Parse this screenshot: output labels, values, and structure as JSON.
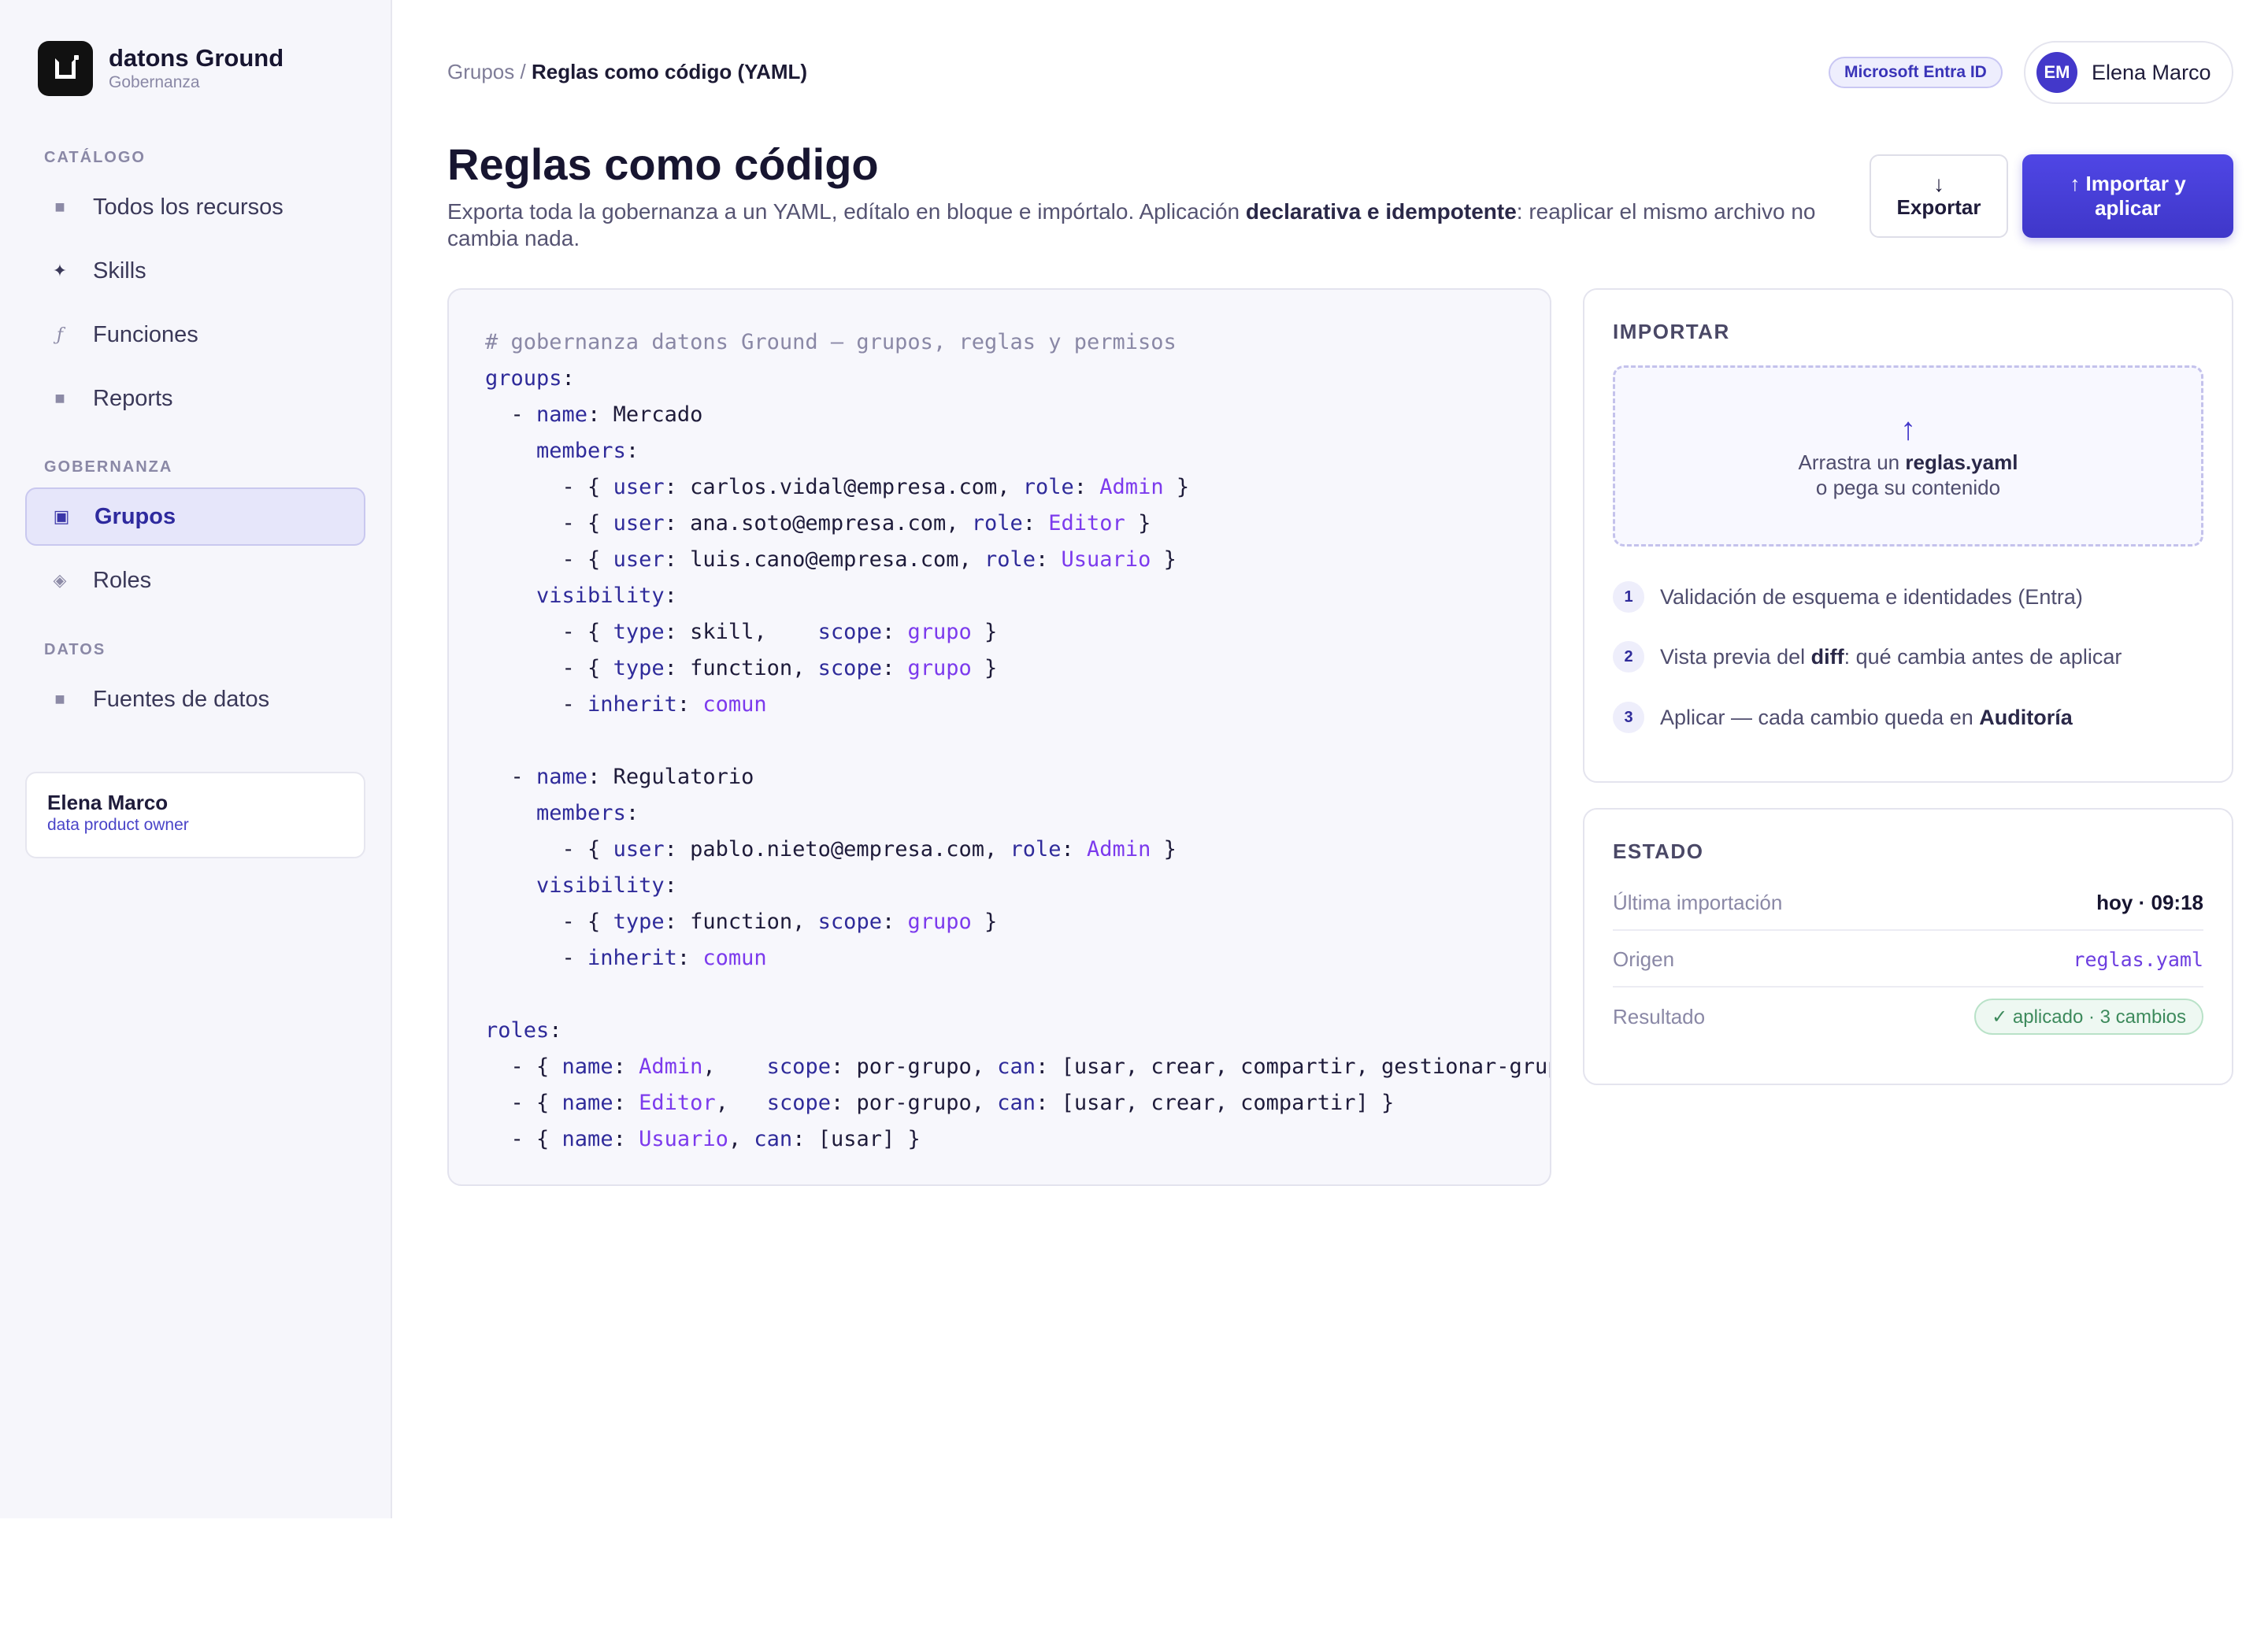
{
  "brand": {
    "name": "datons Ground",
    "subtitle": "Gobernanza"
  },
  "sidebar": {
    "sections": {
      "catalog": "CATÁLOGO",
      "governance": "GOBERNANZA",
      "data": "DATOS"
    },
    "items": [
      {
        "label": "Todos los recursos",
        "icon": "grid-square-icon"
      },
      {
        "label": "Skills",
        "icon": "sparkle-icon"
      },
      {
        "label": "Funciones",
        "icon": "function-icon"
      },
      {
        "label": "Reports",
        "icon": "report-square-icon"
      },
      {
        "label": "Grupos",
        "icon": "group-square-icon",
        "active": true
      },
      {
        "label": "Roles",
        "icon": "diamond-icon"
      },
      {
        "label": "Fuentes de datos",
        "icon": "database-square-icon"
      }
    ],
    "user": {
      "name": "Elena Marco",
      "role": "data product owner"
    }
  },
  "topbar": {
    "breadcrumb_parent": "Grupos",
    "breadcrumb_sep": "/",
    "breadcrumb_current": "Reglas como código (YAML)",
    "idp_badge": "Microsoft Entra ID",
    "user_initials": "EM",
    "user_name": "Elena Marco"
  },
  "header": {
    "title": "Reglas como código",
    "desc_pre": "Exporta toda la gobernanza a un YAML, edítalo en bloque e impórtalo. Aplicación ",
    "desc_bold": "declarativa e idempotente",
    "desc_post": ": reaplicar el mismo archivo no cambia nada.",
    "export_icon": "↓",
    "export_label": "Exportar",
    "import_label": "↑ Importar y aplicar"
  },
  "yaml": {
    "comment": "# gobernanza datons Ground — grupos, reglas y permisos",
    "groups": [
      {
        "name": "Mercado",
        "members": [
          {
            "user": "carlos.vidal@empresa.com",
            "role": "Admin"
          },
          {
            "user": "ana.soto@empresa.com",
            "role": "Editor"
          },
          {
            "user": "luis.cano@empresa.com",
            "role": "Usuario"
          }
        ],
        "visibility": [
          {
            "type": "skill",
            "scope": "grupo"
          },
          {
            "type": "function",
            "scope": "grupo"
          }
        ],
        "inherit": "comun"
      },
      {
        "name": "Regulatorio",
        "members": [
          {
            "user": "pablo.nieto@empresa.com",
            "role": "Admin"
          }
        ],
        "visibility": [
          {
            "type": "function",
            "scope": "grupo"
          }
        ],
        "inherit": "comun"
      }
    ],
    "roles": [
      {
        "name": "Admin",
        "scope": "por-grupo",
        "can": "[usar, crear, compartir, gestionar-grupo]"
      },
      {
        "name": "Editor",
        "scope": "por-grupo",
        "can": "[usar, crear, compartir]"
      },
      {
        "name": "Usuario",
        "can": "[usar]"
      }
    ]
  },
  "import_card": {
    "title": "IMPORTAR",
    "drop_icon": "↑",
    "drop_pre": "Arrastra un ",
    "drop_file": "reglas.yaml",
    "drop_line2": "o pega su contenido",
    "steps": [
      {
        "num": "1",
        "pre": "Validación de esquema e identidades (Entra)",
        "bold": "",
        "post": ""
      },
      {
        "num": "2",
        "pre": "Vista previa del ",
        "bold": "diff",
        "post": ": qué cambia antes de aplicar"
      },
      {
        "num": "3",
        "pre": "Aplicar — cada cambio queda en ",
        "bold": "Auditoría",
        "post": ""
      }
    ]
  },
  "status_card": {
    "title": "ESTADO",
    "rows": [
      {
        "label": "Última importación",
        "value": "hoy · 09:18"
      },
      {
        "label": "Origen",
        "value": "reglas.yaml"
      },
      {
        "label": "Resultado",
        "value": "✓ aplicado · 3 cambios"
      }
    ]
  },
  "colors": {
    "accent": "#4338ca",
    "success": "#3d8a5c",
    "code_value": "#7c3aed"
  }
}
